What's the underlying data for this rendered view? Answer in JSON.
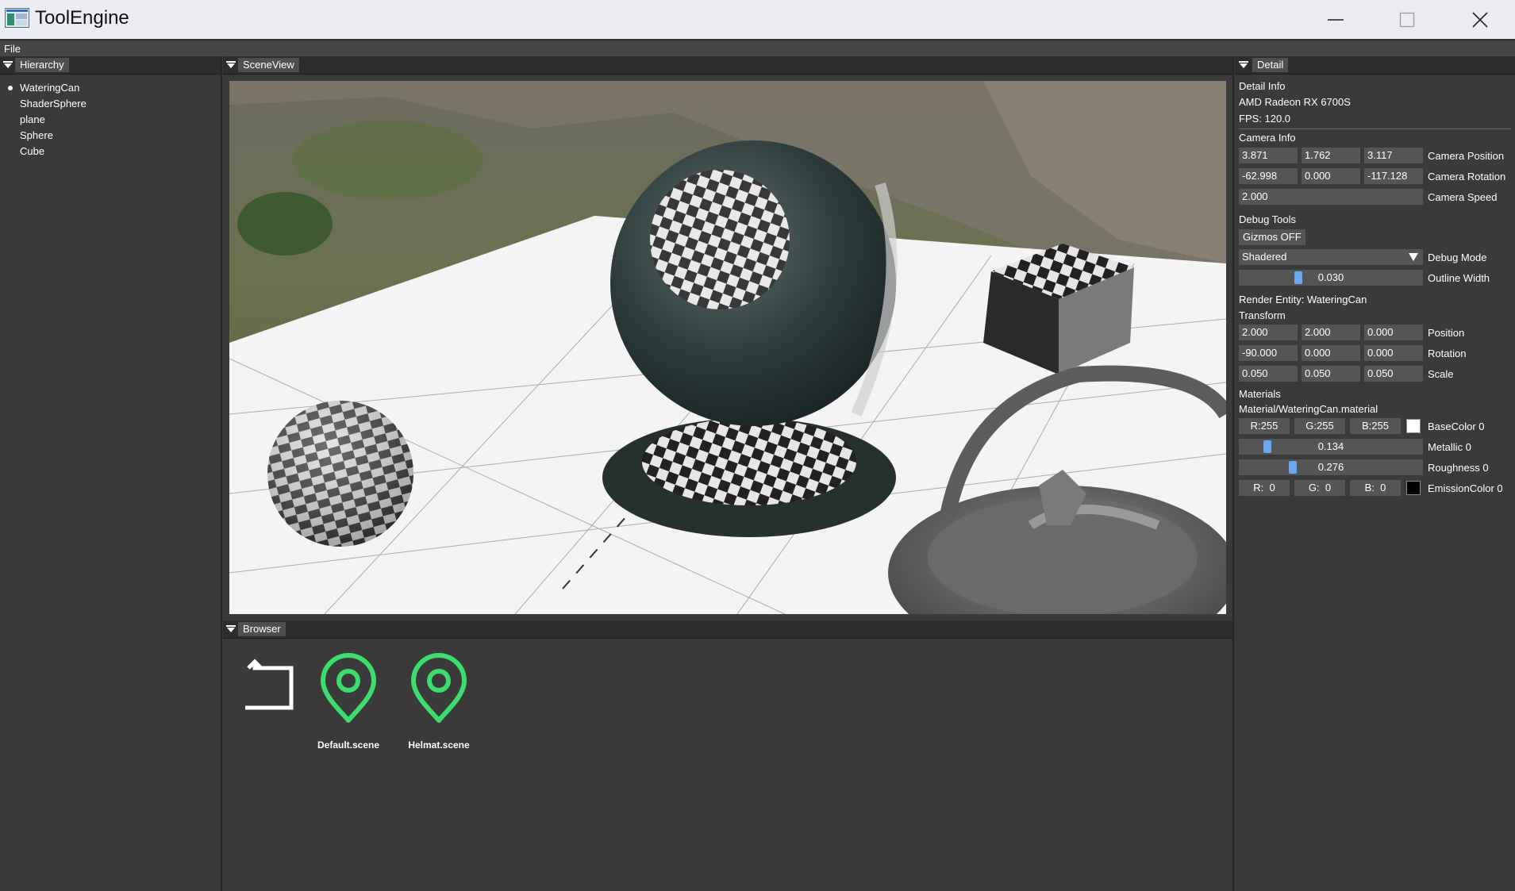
{
  "window": {
    "title": "ToolEngine"
  },
  "menu": {
    "file": "File"
  },
  "hierarchy": {
    "tab": "Hierarchy",
    "items": [
      "WateringCan",
      "ShaderSphere",
      "plane",
      "Sphere",
      "Cube"
    ],
    "selected_index": 0
  },
  "scene_view": {
    "tab": "SceneView"
  },
  "browser": {
    "tab": "Browser",
    "items": [
      {
        "label": "",
        "icon": "back-arrow-icon"
      },
      {
        "label": "Default.scene",
        "icon": "map-pin-icon"
      },
      {
        "label": "Helmat.scene",
        "icon": "map-pin-icon"
      }
    ],
    "accent": "#3ddc6e"
  },
  "detail": {
    "tab": "Detail",
    "detail_info": "Detail Info",
    "gpu": "AMD Radeon RX 6700S",
    "fps": "FPS: 120.0",
    "camera_info": "Camera Info",
    "camera_position": {
      "x": "3.871",
      "y": "1.762",
      "z": "3.117",
      "label": "Camera Position"
    },
    "camera_rotation": {
      "x": "-62.998",
      "y": "0.000",
      "z": "-117.128",
      "label": "Camera Rotation"
    },
    "camera_speed": {
      "value": "2.000",
      "label": "Camera Speed"
    },
    "debug_tools": "Debug Tools",
    "gizmos_button": "Gizmos OFF",
    "debug_mode": {
      "value": "Shadered",
      "label": "Debug Mode"
    },
    "outline_width": {
      "value": "0.030",
      "label": "Outline Width",
      "fraction": 0.27
    },
    "render_entity": "Render Entity: WateringCan",
    "transform": "Transform",
    "position": {
      "x": "2.000",
      "y": "2.000",
      "z": "0.000",
      "label": "Position"
    },
    "rotation": {
      "x": "-90.000",
      "y": "0.000",
      "z": "0.000",
      "label": "Rotation"
    },
    "scale": {
      "x": "0.050",
      "y": "0.050",
      "z": "0.050",
      "label": "Scale"
    },
    "materials": "Materials",
    "material_path": "Material/WateringCan.material",
    "base_color": {
      "r": "R:255",
      "g": "G:255",
      "b": "B:255",
      "label": "BaseColor 0",
      "swatch": "#ffffff"
    },
    "metallic": {
      "value": "0.134",
      "label": "Metallic 0",
      "fraction": 0.134
    },
    "roughness": {
      "value": "0.276",
      "label": "Roughness 0",
      "fraction": 0.276
    },
    "emission_color": {
      "r": "R:  0",
      "g": "G:  0",
      "b": "B:  0",
      "label": "EmissionColor 0",
      "swatch": "#000000"
    }
  },
  "colors": {
    "slider_grab": "#6aa9f0",
    "field_bg": "#555555",
    "panel_bg": "#3a3a3a"
  }
}
